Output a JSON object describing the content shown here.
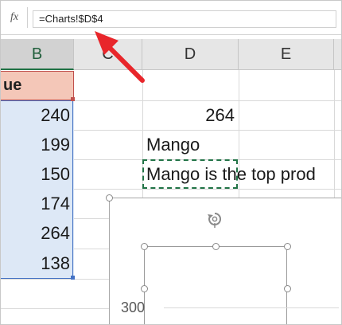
{
  "formula_bar": {
    "fx_label": "fx",
    "formula": "=Charts!$D$4"
  },
  "columns": [
    "B",
    "C",
    "D",
    "E"
  ],
  "cells": {
    "b_header": "ue",
    "b_values": [
      "240",
      "199",
      "150",
      "174",
      "264",
      "138"
    ],
    "d_value": "264",
    "d_fruit": "Mango",
    "d_text": "Mango is the top prod"
  },
  "chart": {
    "y_tick": "300"
  },
  "colors": {
    "accent_green": "#217346",
    "arrow_red": "#e8262b",
    "range_blue": "#4472c4",
    "header_fill": "#f4c7b8"
  },
  "icons": {
    "rotate": "rotate-icon",
    "arrow": "arrow-annotation"
  }
}
